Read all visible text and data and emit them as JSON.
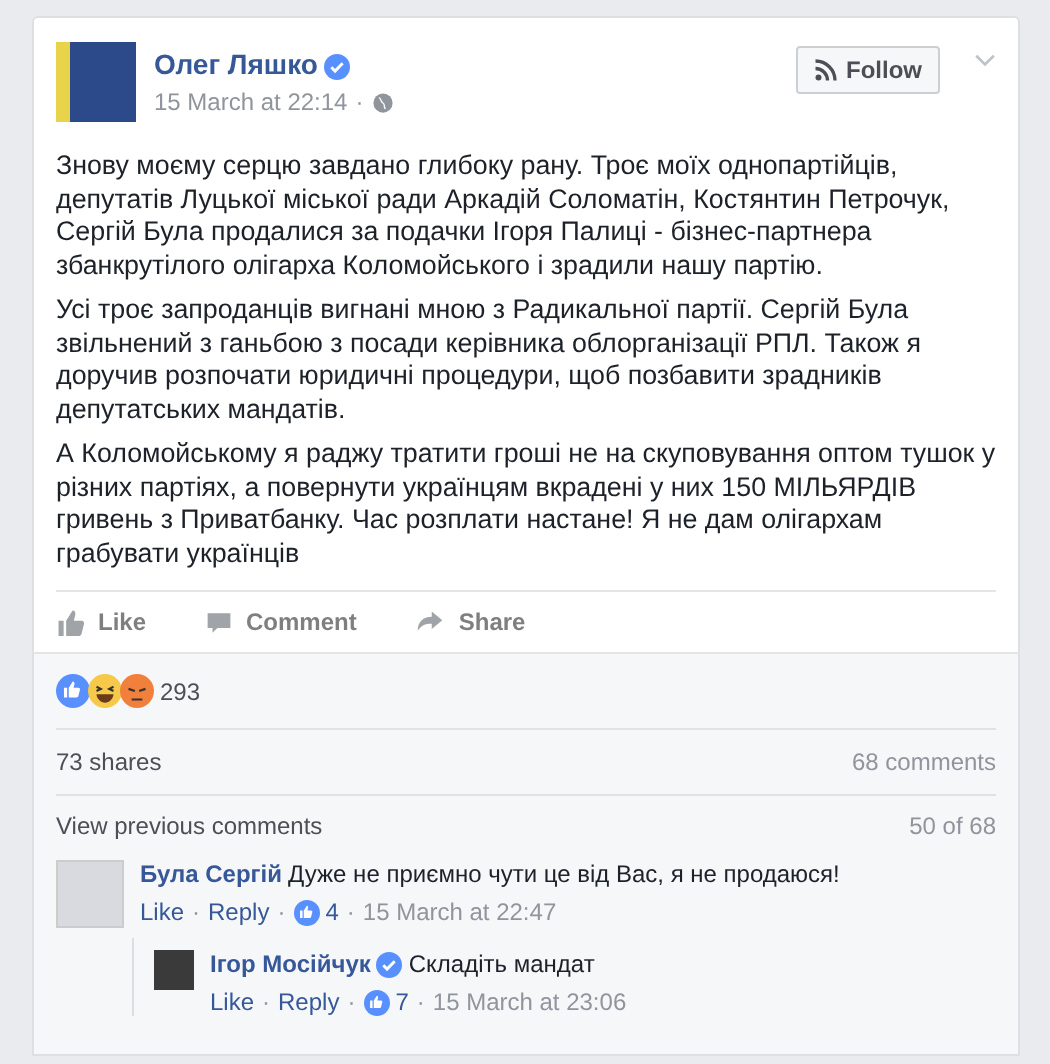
{
  "post": {
    "author": "Олег Ляшко",
    "verified": true,
    "time": "15 March at 22:14",
    "separator": "·",
    "follow_label": "Follow",
    "paragraphs": [
      "Знову моєму серцю завдано глибоку рану. Троє моїх однопартійців, депутатів Луцької міської ради Аркадій Соломатін, Костянтин Петрочук, Сергій Була продалися за подачки Ігоря Палиці - бізнес-партнера збанкрутілого олігарха Коломойського і зрадили нашу партію.",
      "Усі троє запроданців вигнані мною з Радикальної партії. Сергій Була звільнений з ганьбою з посади керівника облорганізації РПЛ. Також я доручив розпочати юридичні процедури, щоб позбавити зрадників депутатських мандатів.",
      "А Коломойському я раджу тратити гроші не на скуповування оптом тушок у різних партіях, а повернути українцям вкрадені у них 150 МІЛЬЯРДІВ гривень з Приватбанку. Час розплати настане! Я не дам олігархам грабувати українців"
    ]
  },
  "actions": [
    {
      "kind": "like",
      "label": "Like"
    },
    {
      "kind": "comment",
      "label": "Comment"
    },
    {
      "kind": "share",
      "label": "Share"
    }
  ],
  "reactions": {
    "items": [
      {
        "kind": "like"
      },
      {
        "kind": "haha"
      },
      {
        "kind": "angry"
      }
    ],
    "count": "293"
  },
  "shares": "73 shares",
  "comments_count": "68 comments",
  "view_previous": "View previous comments",
  "page_info": "50 of 68",
  "comments": [
    {
      "author": "Була Сергій",
      "verified": false,
      "text": "Дуже не приємно чути це від Вас, я не продаюся!",
      "like": "Like",
      "separator": "·",
      "reply": "Reply",
      "likes": "4",
      "time": "15 March at 22:47",
      "children": [
        {
          "author": "Ігор Мосійчук",
          "verified": true,
          "text": "Складіть мандат",
          "like": "Like",
          "separator": "·",
          "reply": "Reply",
          "likes": "7",
          "time": "15 March at 23:06"
        }
      ]
    }
  ]
}
